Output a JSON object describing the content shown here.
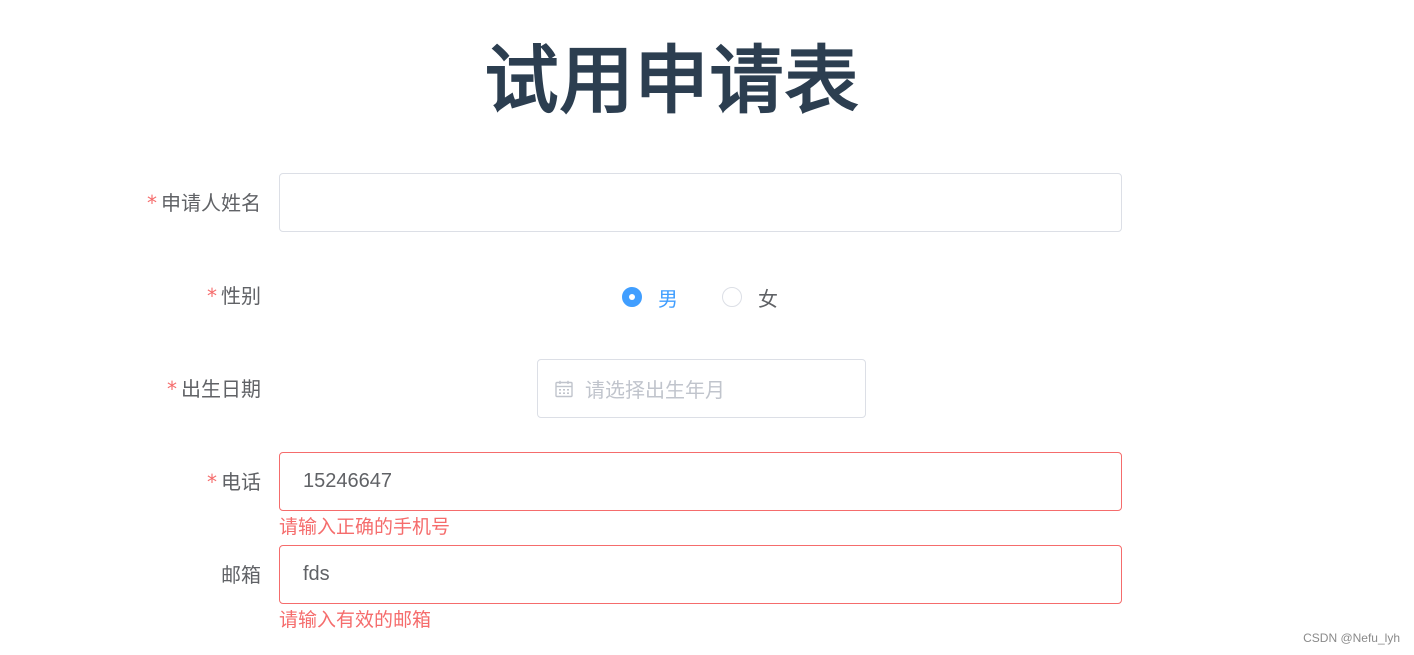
{
  "form": {
    "title": "试用申请表",
    "name_field": {
      "required_mark": "*",
      "label": "申请人姓名",
      "value": ""
    },
    "gender_field": {
      "required_mark": "*",
      "label": "性别",
      "options": [
        "男",
        "女"
      ],
      "selected": "男"
    },
    "birth_field": {
      "required_mark": "*",
      "label": "出生日期",
      "placeholder": "请选择出生年月",
      "icon": "calendar-icon"
    },
    "phone_field": {
      "required_mark": "*",
      "label": "电话",
      "value": "15246647",
      "error": "请输入正确的手机号"
    },
    "email_field": {
      "label": "邮箱",
      "value": "fds",
      "error": "请输入有效的邮箱"
    }
  },
  "watermark": "CSDN @Nefu_lyh",
  "colors": {
    "title": "#2c3e50",
    "accent": "#409eff",
    "error": "#f56c6c",
    "border": "#dcdfe6",
    "placeholder": "#c0c4cc"
  }
}
